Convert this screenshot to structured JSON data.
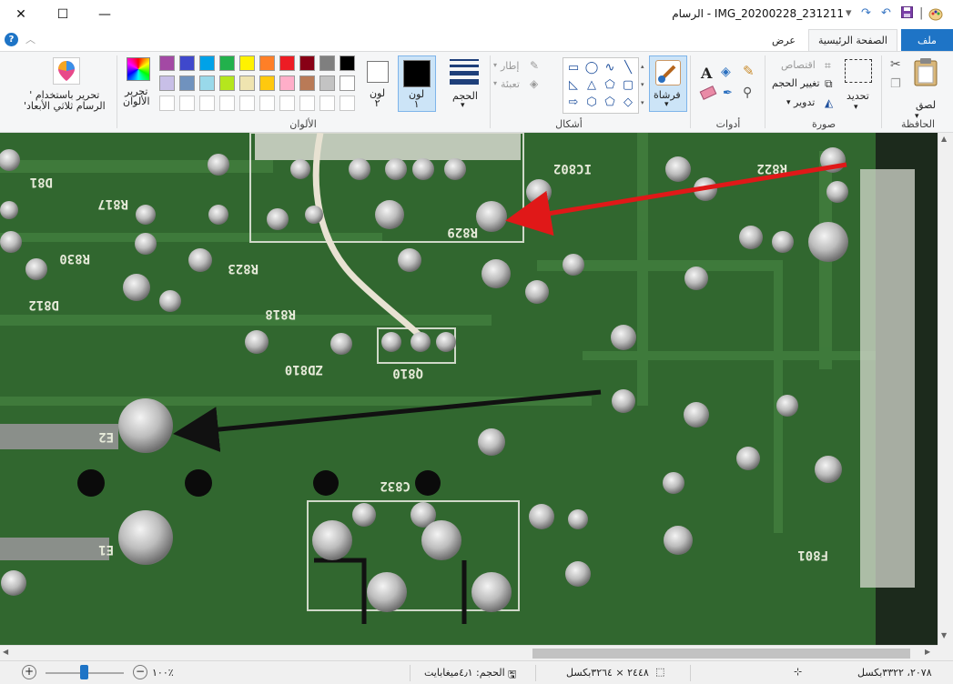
{
  "window": {
    "title": "IMG_20200228_231211 - الرسام",
    "minimize": "—",
    "maximize": "☐",
    "close": "✕"
  },
  "tabs": {
    "file": "ملف",
    "home": "الصفحة الرئيسية",
    "view": "عرض"
  },
  "clipboard": {
    "paste": "لصق",
    "group": "الحافظة"
  },
  "image": {
    "select": "تحديد",
    "crop": "اقتصاص",
    "resize": "تغيير الحجم",
    "rotate": "تدوير",
    "group": "صورة"
  },
  "tools": {
    "group": "أدوات"
  },
  "brushes": {
    "label": "فرشاة"
  },
  "shapes": {
    "outline": "إطار",
    "fill": "تعبئة",
    "group": "أشكال"
  },
  "size": {
    "label": "الحجم"
  },
  "color1": {
    "label": "لون\n١"
  },
  "color2": {
    "label": "لون\n٢"
  },
  "colors": {
    "edit_label": "تحرير\nالألوان",
    "group": "الألوان",
    "palette_row1": [
      "#000000",
      "#7f7f7f",
      "#880015",
      "#ed1c24",
      "#ff7f27",
      "#fff200",
      "#22b14c",
      "#00a2e8",
      "#3f48cc",
      "#a349a4"
    ],
    "palette_row2": [
      "#ffffff",
      "#c3c3c3",
      "#b97a57",
      "#ffaec9",
      "#ffc90e",
      "#efe4b0",
      "#b5e61d",
      "#99d9ea",
      "#7092be",
      "#c8bfe7"
    ],
    "color1_value": "#000000",
    "color2_value": "#ffffff"
  },
  "paint3d": {
    "label": "تحرير باستخدام '\nالرسام ثلاثي الأبعاد'"
  },
  "status": {
    "cursor": "٢٠٧٨، ٣٣٢٢بكسل",
    "dimensions": "٢٤٤٨ × ٣٢٦٤بكسل",
    "filesize": "الحجم: ٤٫١ميغابايت",
    "zoom": "١٠٠٪"
  }
}
